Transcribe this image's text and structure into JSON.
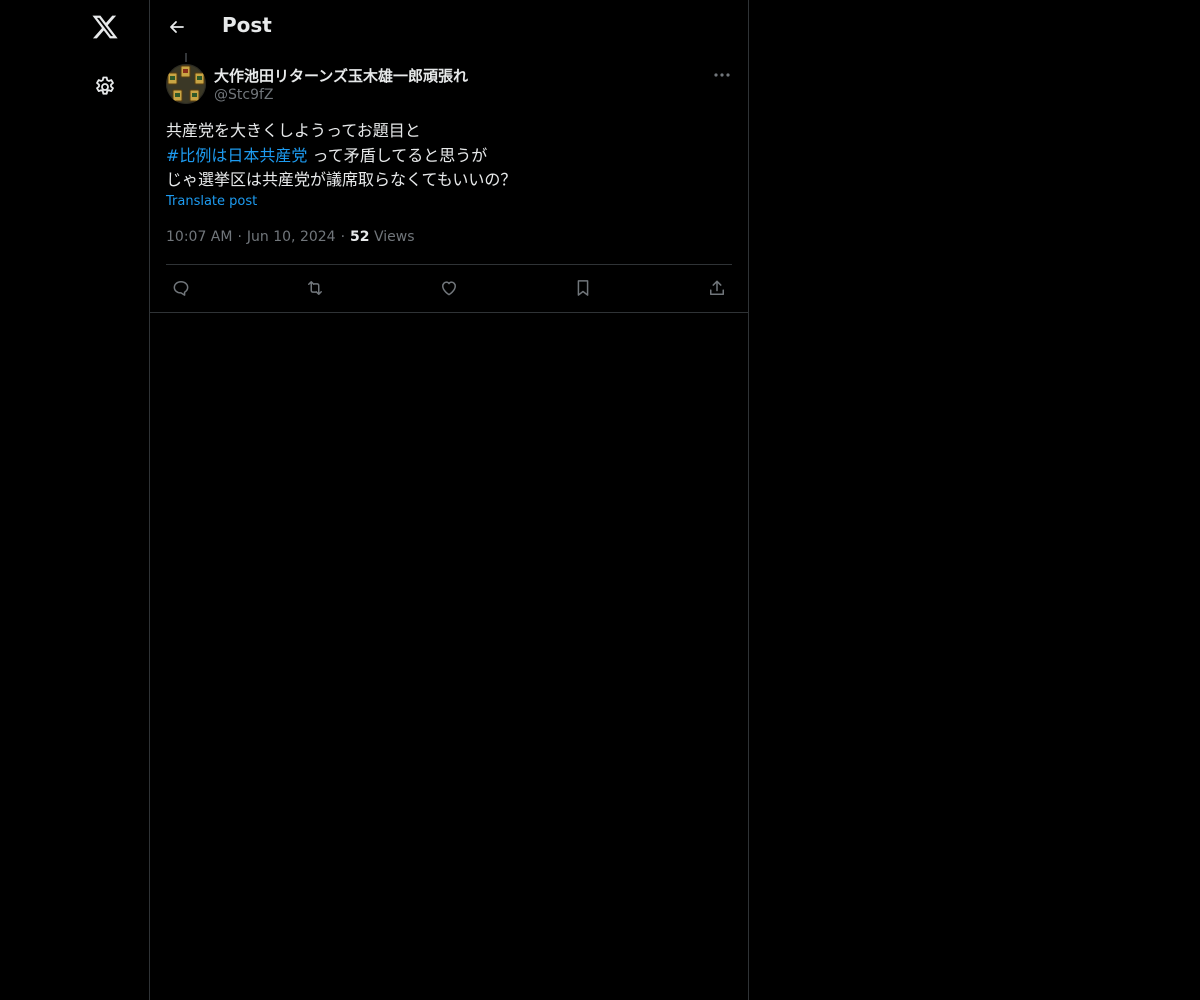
{
  "header": {
    "title": "Post"
  },
  "nav": {
    "logo_icon": "x-logo-icon",
    "settings_icon": "gear-icon"
  },
  "post": {
    "display_name": "大作池田リターンズ玉木雄一郎頑張れ",
    "handle": "@Stc9fZ",
    "text_line1": "共産党を大きくしようってお題目と",
    "hashtag": "#比例は日本共産党",
    "text_line2_rest": " って矛盾してると思うが",
    "text_line3": "じゃ選挙区は共産党が議席取らなくてもいいの？",
    "translate_label": "Translate post",
    "time": "10:07 AM",
    "date": "Jun 10, 2024",
    "separator": "·",
    "views_count": "52",
    "views_label": " Views"
  },
  "actions": [
    {
      "name": "reply",
      "icon": "reply-icon"
    },
    {
      "name": "repost",
      "icon": "repost-icon"
    },
    {
      "name": "like",
      "icon": "heart-icon"
    },
    {
      "name": "bookmark",
      "icon": "bookmark-icon"
    },
    {
      "name": "share",
      "icon": "share-icon"
    }
  ],
  "colors": {
    "background": "#000000",
    "text_primary": "#e7e9ea",
    "text_secondary": "#71767b",
    "link": "#1d9bf0",
    "border": "#2f3336"
  }
}
